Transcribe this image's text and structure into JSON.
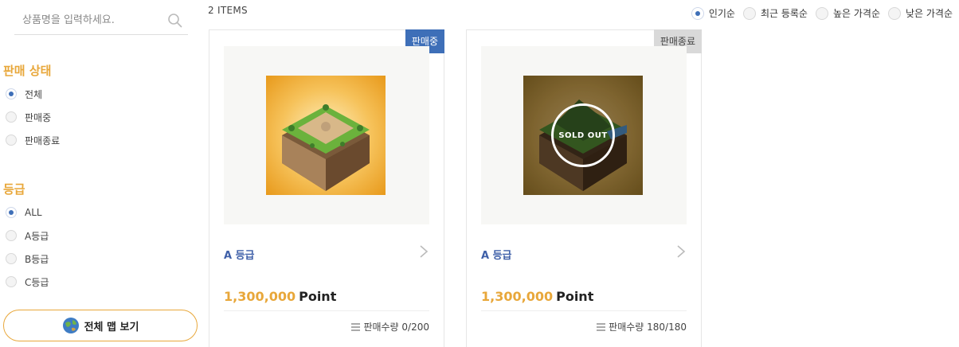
{
  "search": {
    "placeholder": "상품명을 입력하세요."
  },
  "filters": {
    "sale_status": {
      "title": "판매 상태",
      "options": [
        {
          "label": "전체",
          "checked": true
        },
        {
          "label": "판매중",
          "checked": false
        },
        {
          "label": "판매종료",
          "checked": false
        }
      ]
    },
    "grade": {
      "title": "등급",
      "options": [
        {
          "label": "ALL",
          "checked": true
        },
        {
          "label": "A등급",
          "checked": false
        },
        {
          "label": "B등급",
          "checked": false
        },
        {
          "label": "C등급",
          "checked": false
        }
      ]
    }
  },
  "map_button": {
    "label": "전체 맵 보기",
    "icon": "globe-icon"
  },
  "item_count": "2 ITEMS",
  "sort": {
    "options": [
      {
        "label": "인기순",
        "checked": true
      },
      {
        "label": "최근 등록순",
        "checked": false
      },
      {
        "label": "높은 가격순",
        "checked": false
      },
      {
        "label": "낮은 가격순",
        "checked": false
      }
    ]
  },
  "products": [
    {
      "status": "판매중",
      "grade": "A 등급",
      "price": "1,300,000",
      "price_unit": "Point",
      "quantity": "판매수량 0/200",
      "sold_out": false
    },
    {
      "status": "판매종료",
      "grade": "A 등급",
      "price": "1,300,000",
      "price_unit": "Point",
      "quantity": "판매수량 180/180",
      "sold_out": true,
      "sold_out_label": "SOLD OUT"
    }
  ],
  "colors": {
    "accent_orange": "#e8a73a",
    "accent_blue": "#3e6fb8",
    "grade_blue": "#3e5fa8",
    "badge_gray": "#d9d9d9"
  }
}
